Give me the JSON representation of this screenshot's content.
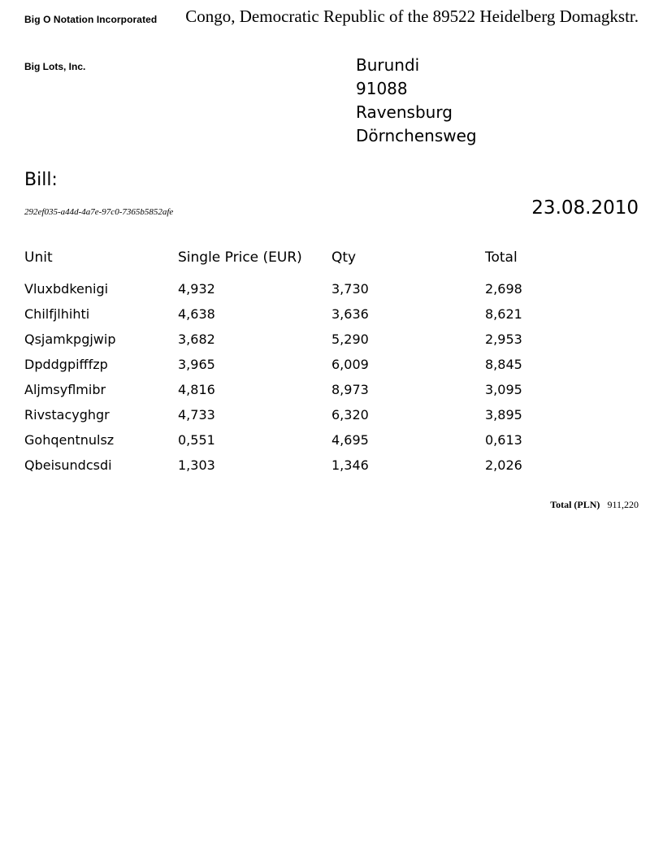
{
  "sender": {
    "company": "Big O Notation Incorporated",
    "address": "Congo, Democratic Republic of the 89522 Heidelberg Domagkstr."
  },
  "recipient": {
    "company": "Big Lots, Inc.",
    "address_lines": [
      "Burundi",
      "91088",
      "Ravensburg",
      "Dörnchensweg"
    ]
  },
  "bill": {
    "label": "Bill:",
    "id": "292ef035-a44d-4a7e-97c0-7365b5852afe",
    "date": "23.08.2010"
  },
  "table": {
    "headers": [
      "Unit",
      "Single Price (EUR)",
      "Qty",
      "Total"
    ],
    "rows": [
      [
        "Vluxbdkenigi",
        "4,932",
        "3,730",
        "2,698"
      ],
      [
        "Chilfjlhihti",
        "4,638",
        "3,636",
        "8,621"
      ],
      [
        "Qsjamkpgjwip",
        "3,682",
        "5,290",
        "2,953"
      ],
      [
        "Dpddgpifffzp",
        "3,965",
        "6,009",
        "8,845"
      ],
      [
        "Aljmsyflmibr",
        "4,816",
        "8,973",
        "3,095"
      ],
      [
        "Rivstacyghgr",
        "4,733",
        "6,320",
        "3,895"
      ],
      [
        "Gohqentnulsz",
        "0,551",
        "4,695",
        "0,613"
      ],
      [
        "Qbeisundcsdi",
        "1,303",
        "1,346",
        "2,026"
      ]
    ]
  },
  "total": {
    "label": "Total (PLN)",
    "value": "911,220"
  }
}
